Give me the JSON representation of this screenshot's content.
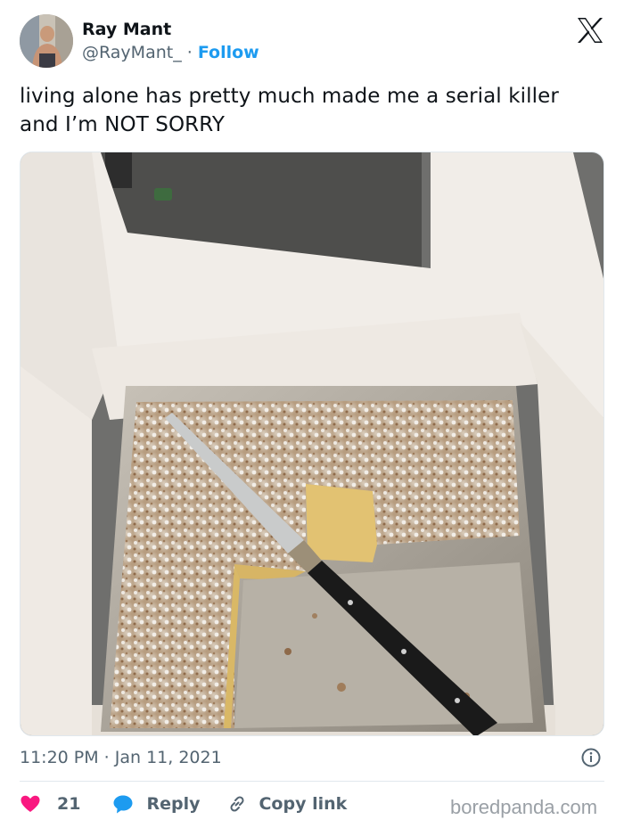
{
  "tweet": {
    "author_name": "Ray Mant",
    "author_handle": "@RayMant_",
    "separator": " · ",
    "follow_label": "Follow",
    "text": "living alone has pretty much made me a serial killer and I’m NOT SORRY",
    "timestamp": "11:20 PM · Jan 11, 2021",
    "likes_count": "21",
    "reply_label": "Reply",
    "copy_link_label": "Copy link"
  },
  "watermark": "boredpanda.com",
  "icons": {
    "platform_logo": "x-logo-icon",
    "info": "info-icon",
    "like": "heart-icon",
    "reply": "speech-bubble-icon",
    "copy_link": "link-icon"
  },
  "colors": {
    "accent": "#1d9bf0",
    "like": "#f91880",
    "secondary_text": "#536471",
    "primary_text": "#0f1419",
    "divider": "#e1e8ed"
  }
}
